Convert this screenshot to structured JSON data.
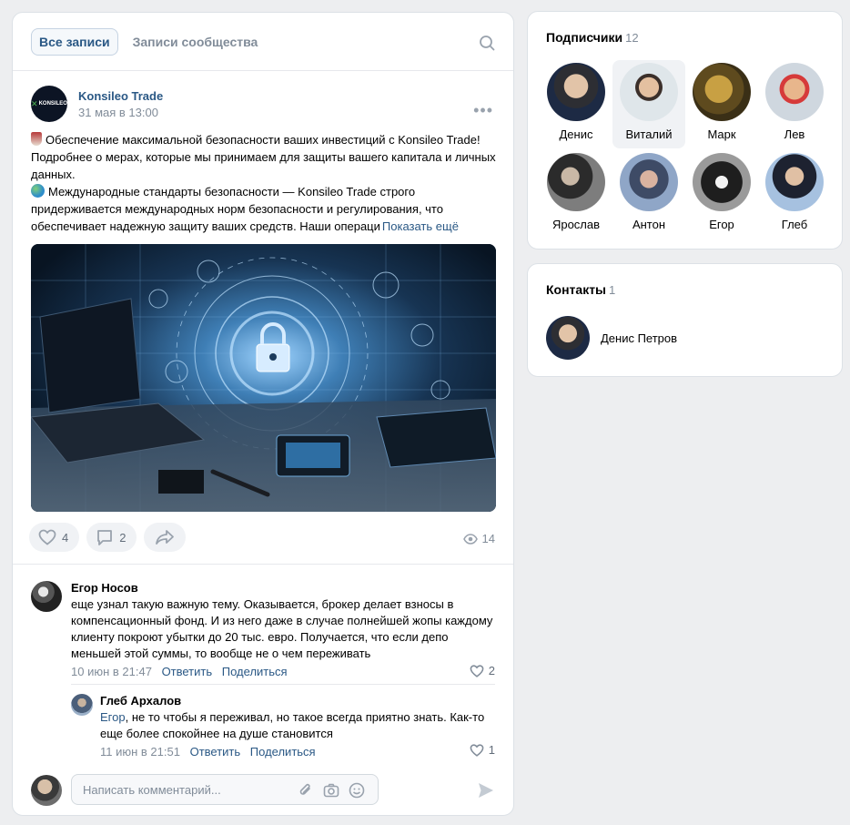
{
  "feed": {
    "tabs": [
      {
        "label": "Все записи",
        "active": true
      },
      {
        "label": "Записи сообщества",
        "active": false
      }
    ],
    "post": {
      "author": "Konsileo Trade",
      "logo_text": "KONSILEO",
      "date": "31 мая в 13:00",
      "text_line1": "Обеспечение максимальной безопасности ваших инвестиций с Konsileo Trade! Подробнее о мерах, которые мы принимаем для защиты вашего капитала и личных данных.",
      "text_line2": "Международные стандарты безопасности — Konsileo Trade строго придерживается международных норм безопасности и регулирования, что обеспечивает надежную защиту ваших средств. Наши операци",
      "show_more": "Показать ещё",
      "likes": "4",
      "comments": "2",
      "views": "14"
    },
    "comments": [
      {
        "name": "Егор Носов",
        "text": "еще узнал такую важную тему. Оказывается, брокер делает взносы в компенсационный фонд. И из него даже в случае полнейшей жопы каждому клиенту покроют убытки до 20 тыс. евро. Получается, что если депо меньшей этой суммы, то вообще не о чем переживать",
        "date": "10 июн в 21:47",
        "reply": "Ответить",
        "share": "Поделиться",
        "likes": "2"
      },
      {
        "name": "Глеб Архалов",
        "mention": "Егор",
        "text": ", не то чтобы я переживал, но такое всегда приятно знать. Как-то еще более спокойнее на душе становится",
        "date": "11 июн в 21:51",
        "reply": "Ответить",
        "share": "Поделиться",
        "likes": "1"
      }
    ],
    "composer": {
      "placeholder": "Написать комментарий..."
    }
  },
  "subscribers": {
    "title": "Подписчики",
    "count": "12",
    "items": [
      {
        "name": "Денис"
      },
      {
        "name": "Виталий"
      },
      {
        "name": "Марк"
      },
      {
        "name": "Лев"
      },
      {
        "name": "Ярослав"
      },
      {
        "name": "Антон"
      },
      {
        "name": "Егор"
      },
      {
        "name": "Глеб"
      }
    ]
  },
  "contacts": {
    "title": "Контакты",
    "count": "1",
    "name": "Денис Петров"
  },
  "colors": {
    "link": "#2a5885",
    "muted": "#818c99",
    "background": "#edeef0"
  }
}
